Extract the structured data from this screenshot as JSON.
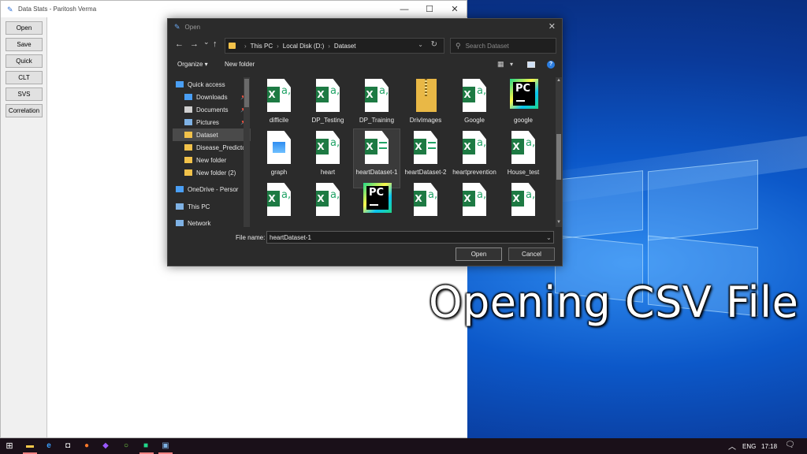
{
  "app": {
    "title": "Data Stats  - Paritosh Verma",
    "window_controls": {
      "minimize": "—",
      "maximize": "☐",
      "close": "✕"
    },
    "buttons": [
      "Open",
      "Save",
      "Quick",
      "CLT",
      "SVS",
      "Correlation"
    ]
  },
  "dialog": {
    "title": "Open",
    "close_glyph": "✕",
    "nav": {
      "back": "←",
      "forward": "→",
      "recent": "⌄",
      "up": "↑"
    },
    "breadcrumb": [
      "This PC",
      "Local Disk (D:)",
      "Dataset"
    ],
    "search_placeholder": "Search Dataset",
    "commands": {
      "organize": "Organize ▾",
      "new_folder": "New folder",
      "help": "?"
    },
    "nav_pane": [
      {
        "label": "Quick access",
        "icon": "star-icon",
        "color": "#4a9ff5",
        "indent": 0,
        "pinned": false,
        "selected": false
      },
      {
        "label": "Downloads",
        "icon": "download-icon",
        "color": "#4a9ff5",
        "indent": 1,
        "pinned": true,
        "selected": false
      },
      {
        "label": "Documents",
        "icon": "document-icon",
        "color": "#d0d0d0",
        "indent": 1,
        "pinned": true,
        "selected": false
      },
      {
        "label": "Pictures",
        "icon": "pictures-icon",
        "color": "#7fb2e5",
        "indent": 1,
        "pinned": true,
        "selected": false
      },
      {
        "label": "Dataset",
        "icon": "folder-icon",
        "color": "#f2c24a",
        "indent": 1,
        "pinned": false,
        "selected": true
      },
      {
        "label": "Disease_Predictc",
        "icon": "folder-icon",
        "color": "#f2c24a",
        "indent": 1,
        "pinned": false,
        "selected": false
      },
      {
        "label": "New folder",
        "icon": "folder-icon",
        "color": "#f2c24a",
        "indent": 1,
        "pinned": false,
        "selected": false
      },
      {
        "label": "New folder (2)",
        "icon": "folder-icon",
        "color": "#f2c24a",
        "indent": 1,
        "pinned": false,
        "selected": false
      },
      {
        "label": "OneDrive - Persor",
        "icon": "cloud-icon",
        "color": "#4a9ff5",
        "indent": 0,
        "pinned": false,
        "selected": false
      },
      {
        "label": "This PC",
        "icon": "computer-icon",
        "color": "#7fb2e5",
        "indent": 0,
        "pinned": false,
        "selected": false
      },
      {
        "label": "Network",
        "icon": "network-icon",
        "color": "#7fb2e5",
        "indent": 0,
        "pinned": false,
        "selected": false
      }
    ],
    "files": [
      {
        "name": "difficile",
        "type": "excel-csv"
      },
      {
        "name": "DP_Testing",
        "type": "excel-csv"
      },
      {
        "name": "DP_Training",
        "type": "excel-csv"
      },
      {
        "name": "DrivImages",
        "type": "zip"
      },
      {
        "name": "Google",
        "type": "excel-csv"
      },
      {
        "name": "google",
        "type": "pycharm"
      },
      {
        "name": "graph",
        "type": "image"
      },
      {
        "name": "heart",
        "type": "excel-csv"
      },
      {
        "name": "heartDataset-1",
        "type": "excel-xlsx",
        "selected": true
      },
      {
        "name": "heartDataset-2",
        "type": "excel-xlsx"
      },
      {
        "name": "heartprevention",
        "type": "excel-csv"
      },
      {
        "name": "House_test",
        "type": "excel-csv"
      },
      {
        "name": "",
        "type": "excel-csv"
      },
      {
        "name": "",
        "type": "excel-csv"
      },
      {
        "name": "",
        "type": "pycharm"
      },
      {
        "name": "",
        "type": "excel-csv"
      },
      {
        "name": "",
        "type": "excel-csv"
      },
      {
        "name": "",
        "type": "excel-csv"
      }
    ],
    "file_name_label": "File name:",
    "file_name_value": "heartDataset-1",
    "open_label": "Open",
    "cancel_label": "Cancel"
  },
  "caption": "Opening CSV File",
  "taskbar": {
    "tray": {
      "chevron": "︿",
      "language": "ENG",
      "time": "17:18",
      "notification": "🗨"
    }
  }
}
